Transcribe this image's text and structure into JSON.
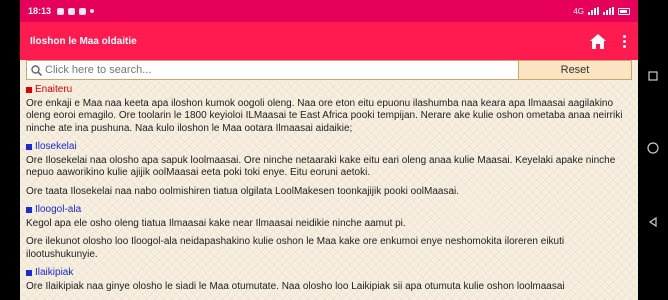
{
  "status_bar": {
    "time": "18:13",
    "signal_text": "4G"
  },
  "app_bar": {
    "title": "Iloshon le Maa oldaitie",
    "home_icon": "home-icon",
    "menu_icon": "more-vert-icon"
  },
  "search": {
    "placeholder": "Click here to search...",
    "value": "",
    "reset_label": "Reset"
  },
  "sections": [
    {
      "heading": "Enaiteru",
      "heading_color": "#dd0000",
      "paragraphs": [
        "Ore enkaji e Maa naa keeta apa iloshon kumok oogoli oleng. Naa ore eton eitu epuonu ilashumba naa keara apa Ilmaasai aagilakino oleng eoroi emagilo. Ore toolarin le 1800 keyioloi ILMaasai te East Africa pooki tempijan. Nerare ake kulie oshon ometaba anaa neirriki ninche ate ina pushuna. Naa kulo iloshon le Maa ootara Ilmaasai aidaikie;"
      ]
    },
    {
      "heading": "Ilosekelai",
      "heading_color": "#1a2bd6",
      "paragraphs": [
        "Ore Ilosekelai naa olosho apa sapuk loolmaasai. Ore ninche netaaraki kake eitu eari oleng anaa kulie Maasai. Keyelaki apake ninche nepuo aaworikino kulie ajijik oolMaasai eeta poki toki enye. Eitu eoruni aetoki.",
        "Ore taata Ilosekelai naa nabo oolmishiren tiatua olgilata LoolMakesen toonkajijik pooki oolMaasai."
      ]
    },
    {
      "heading": "Iloogol-ala",
      "heading_color": "#1a2bd6",
      "paragraphs": [
        "Kegol apa ele osho oleng tiatua Ilmaasai kake near Ilmaasai neidikie ninche aamut pi.",
        "Ore ilekunot olosho loo Iloogol-ala neidapashakino kulie oshon le Maa kake ore enkumoi enye neshomokita iloreren eikuti ilootushukunyie."
      ]
    },
    {
      "heading": "Ilaikipiak",
      "heading_color": "#1a2bd6",
      "paragraphs": [
        "Ore Ilaikipiak naa ginye olosho le siadi le Maa otumutate. Naa olosho loo Laikipiak sii apa otumuta kulie oshon loolmaasai"
      ]
    }
  ]
}
